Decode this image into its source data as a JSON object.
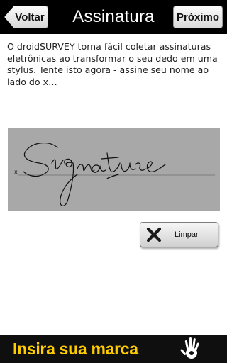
{
  "header": {
    "title": "Assinatura",
    "back_label": "Voltar",
    "next_label": "Próximo"
  },
  "intro": {
    "text": "O droidSURVEY torna fácil coletar assinaturas eletrônicas ao transformar o seu dedo em uma stylus. Tente isto agora - assine seu nome ao lado do x…"
  },
  "signature_pad": {
    "x_mark": "x",
    "background_color": "#a8a8a8"
  },
  "clear_button": {
    "label": "Limpar",
    "icon": "x-icon"
  },
  "brand_bar": {
    "text": "Insira sua marca",
    "text_color": "#ffcc00",
    "logo_icon": "hand-icon"
  },
  "colors": {
    "header_bg": "#000000",
    "page_bg": "#ffffff"
  }
}
